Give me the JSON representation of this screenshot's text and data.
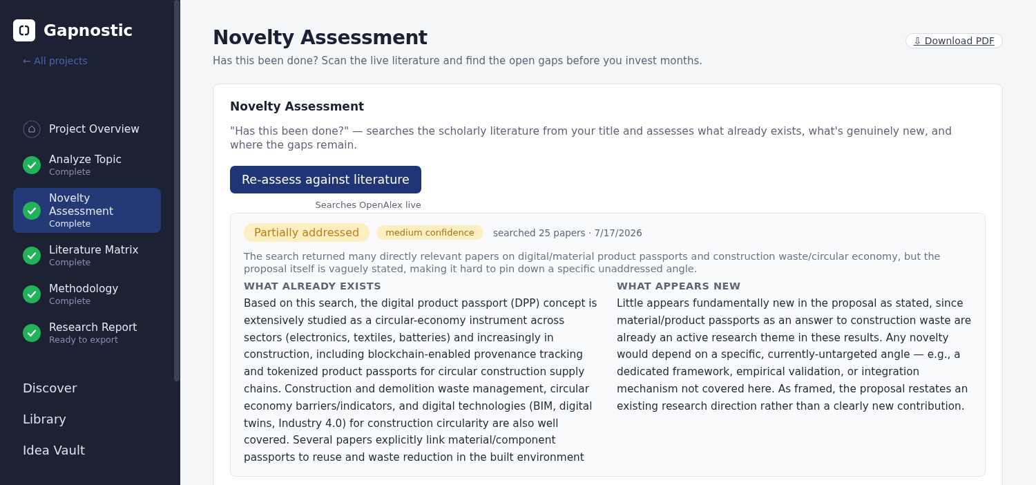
{
  "sidebar": {
    "brand": "Gapnostic",
    "back_link": "← All projects",
    "steps": [
      {
        "kind": "overview",
        "label": "Project Overview",
        "selected": false
      },
      {
        "kind": "step",
        "label": "Analyze Topic",
        "status": "Complete",
        "complete": true,
        "selected": false
      },
      {
        "kind": "step",
        "label": "Novelty Assessment",
        "status": "Complete",
        "complete": true,
        "selected": true
      },
      {
        "kind": "step",
        "label": "Literature Matrix",
        "status": "Complete",
        "complete": true,
        "selected": false
      },
      {
        "kind": "step",
        "label": "Methodology",
        "status": "Complete",
        "complete": true,
        "selected": false
      },
      {
        "kind": "step",
        "label": "Research Report",
        "status": "Ready to export",
        "complete": true,
        "selected": false
      }
    ],
    "nav": [
      "Discover",
      "Library",
      "Idea Vault"
    ]
  },
  "header": {
    "title": "Novelty Assessment",
    "subtitle": "Has this been done? Scan the live literature and find the open gaps before you invest months.",
    "download": "⇩ Download PDF"
  },
  "card": {
    "title": "Novelty Assessment",
    "description": "\"Has this been done?\" — searches the scholarly literature from your title and assesses what already exists, what's genuinely new, and where the gaps remain.",
    "button": "Re-assess against literature",
    "button_note": "Searches OpenAlex live",
    "result": {
      "verdict": "Partially addressed",
      "confidence": "medium confidence",
      "meta": "searched 25 papers · 7/17/2026",
      "summary": "The search returned many directly relevant papers on digital/material product passports and construction waste/circular economy, but the proposal itself is vaguely stated, making it hard to pin down a specific unaddressed angle.",
      "sections": [
        {
          "heading": "WHAT ALREADY EXISTS",
          "text": "Based on this search, the digital product passport (DPP) concept is extensively studied as a circular-economy instrument across sectors (electronics, textiles, batteries) and increasingly in construction, including blockchain-enabled provenance tracking and tokenized product passports for circular construction supply chains. Construction and demolition waste management, circular economy barriers/indicators, and digital technologies (BIM, digital twins, Industry 4.0) for construction circularity are also well covered. Several papers explicitly link material/component passports to reuse and waste reduction in the built environment"
        },
        {
          "heading": "WHAT APPEARS NEW",
          "text": "Little appears fundamentally new in the proposal as stated, since material/product passports as an answer to construction waste are already an active research theme in these results. Any novelty would depend on a specific, currently-untargeted angle — e.g., a dedicated framework, empirical validation, or integration mechanism not covered here. As framed, the proposal restates an existing research direction rather than a clearly new contribution."
        }
      ]
    }
  }
}
